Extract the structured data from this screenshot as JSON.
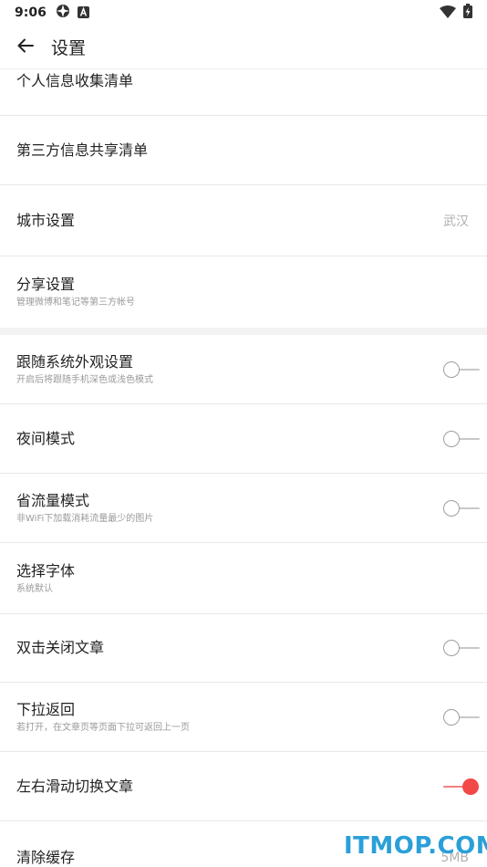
{
  "status_bar": {
    "time": "9:06",
    "icons_left": [
      "gear-status-icon",
      "a-badge-icon"
    ],
    "icons_right": [
      "wifi-icon",
      "battery-charging-icon"
    ]
  },
  "app_bar": {
    "title": "设置",
    "back_icon": "arrow-left-icon"
  },
  "items": [
    {
      "label": "个人信息收集清单"
    },
    {
      "label": "第三方信息共享清单"
    },
    {
      "label": "城市设置",
      "value": "武汉"
    },
    {
      "label": "分享设置",
      "sub": "管理微博和笔记等第三方帐号"
    },
    {
      "label": "跟随系统外观设置",
      "sub": "开启后将跟随手机深色或浅色模式",
      "toggle": false
    },
    {
      "label": "夜间模式",
      "toggle": false
    },
    {
      "label": "省流量模式",
      "sub": "非WiFi下加载消耗流量最少的图片",
      "toggle": false
    },
    {
      "label": "选择字体",
      "sub": "系统默认"
    },
    {
      "label": "双击关闭文章",
      "toggle": false
    },
    {
      "label": "下拉返回",
      "sub": "若打开，在文章页等页面下拉可返回上一页",
      "toggle": false
    },
    {
      "label": "左右滑动切换文章",
      "toggle": true
    },
    {
      "label": "清除缓存",
      "value": "5MB"
    }
  ],
  "watermark": "ITMOP.COM",
  "colors": {
    "accent": "#f24848",
    "divider": "#e8e8e8",
    "section_gap": "#f2f2f2"
  }
}
